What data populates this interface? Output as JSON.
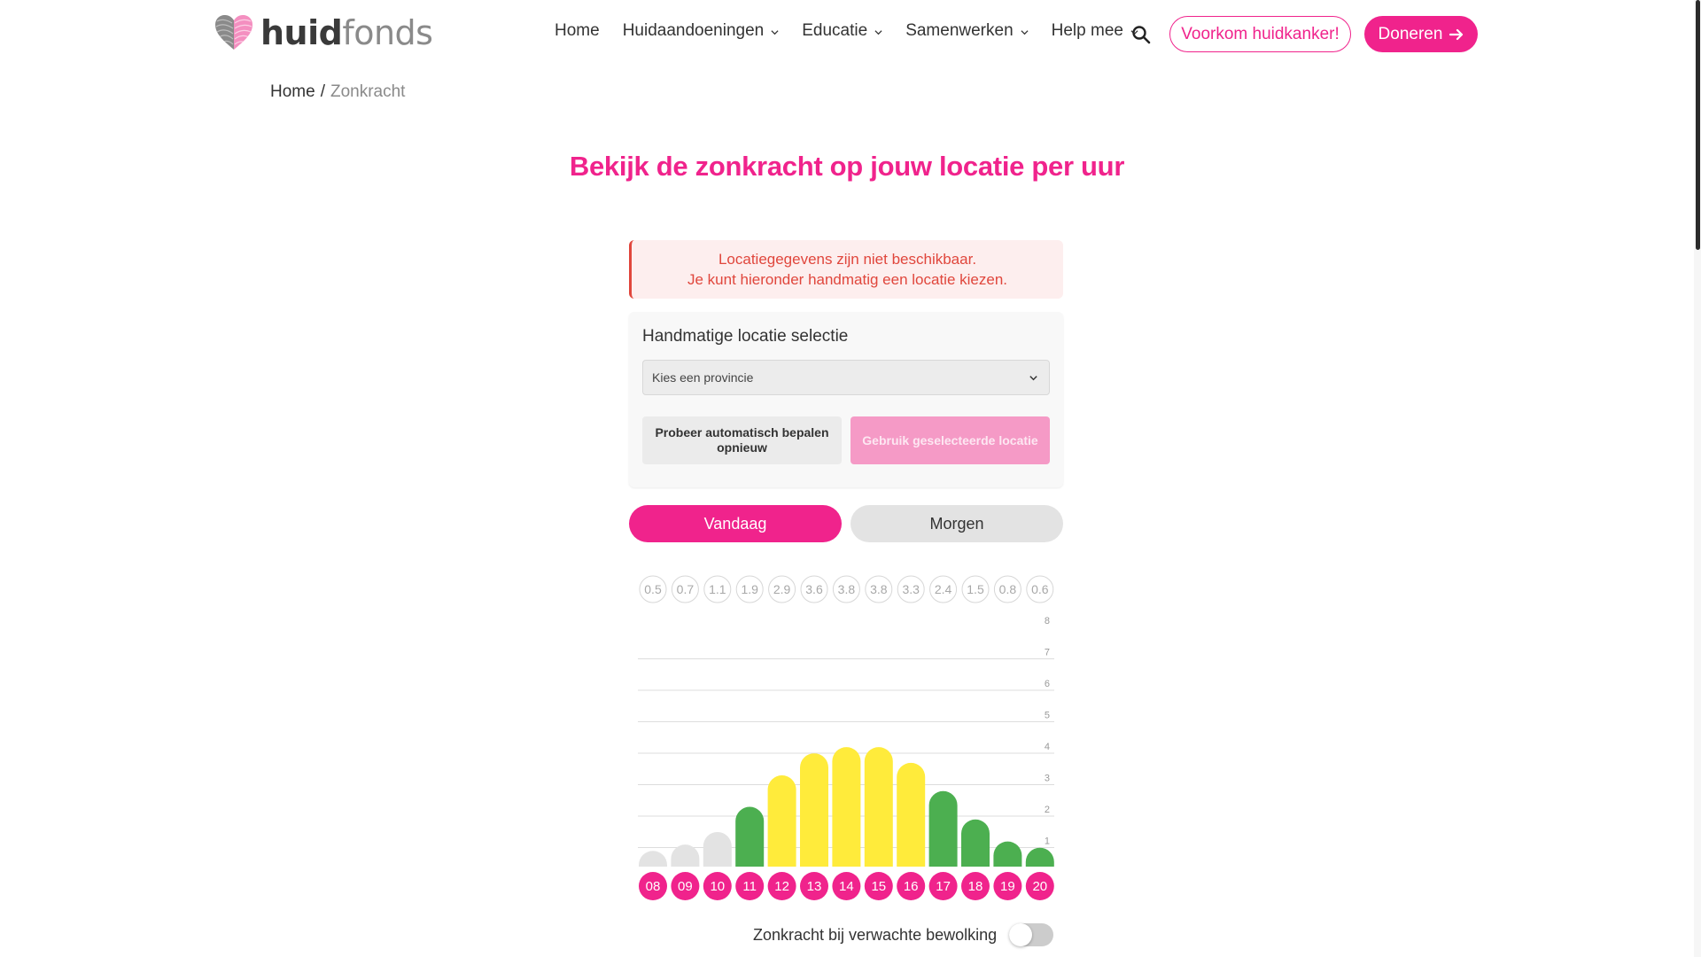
{
  "header": {
    "logo": {
      "text_bold": "huid",
      "text_light": "fonds"
    },
    "nav": [
      {
        "label": "Home",
        "has_dropdown": false
      },
      {
        "label": "Huidaandoeningen",
        "has_dropdown": true
      },
      {
        "label": "Educatie",
        "has_dropdown": true
      },
      {
        "label": "Samenwerken",
        "has_dropdown": true
      },
      {
        "label": "Help mee",
        "has_dropdown": true
      }
    ],
    "search_icon": "search-icon",
    "cta_outline": "Voorkom huidkanker!",
    "cta_fill": "Doneren"
  },
  "breadcrumb": {
    "home": "Home",
    "separator": "/",
    "current": "Zonkracht"
  },
  "page_title": "Bekijk de zonkracht op jouw locatie per uur",
  "alert": {
    "line1": "Locatiegegevens zijn niet beschikbaar.",
    "line2": "Je kunt hieronder handmatig een locatie kiezen."
  },
  "manual_location": {
    "title": "Handmatige locatie selectie",
    "select_value": "Kies een provincie",
    "retry_button": "Probeer automatisch bepalen opnieuw",
    "use_button": "Gebruik geselecteerde locatie"
  },
  "day_toggle": {
    "today": "Vandaag",
    "tomorrow": "Morgen",
    "selected": "today"
  },
  "chart_data": {
    "type": "bar",
    "categories": [
      "08",
      "09",
      "10",
      "11",
      "12",
      "13",
      "14",
      "15",
      "16",
      "17",
      "18",
      "19",
      "20"
    ],
    "values": [
      0.5,
      0.7,
      1.1,
      1.9,
      2.9,
      3.6,
      3.8,
      3.8,
      3.3,
      2.4,
      1.5,
      0.8,
      0.6
    ],
    "value_labels": [
      "0.5",
      "0.7",
      "1.1",
      "1.9",
      "2.9",
      "3.6",
      "3.8",
      "3.8",
      "3.3",
      "2.4",
      "1.5",
      "0.8",
      "0.6"
    ],
    "y_ticks": [
      "8",
      "7",
      "6",
      "5",
      "4",
      "3",
      "2",
      "1"
    ],
    "ylim": [
      0,
      8
    ],
    "grid": true,
    "bar_colors": [
      "#e3e3e3",
      "#e3e3e3",
      "#e3e3e3",
      "#4caf50",
      "#ffeb3b",
      "#ffeb3b",
      "#ffeb3b",
      "#ffeb3b",
      "#ffeb3b",
      "#4caf50",
      "#4caf50",
      "#4caf50",
      "#4caf50"
    ],
    "hour_badge_color": "#f0238c"
  },
  "cloud_toggle": {
    "label": "Zonkracht bij verwachte bewolking",
    "on": false
  },
  "colors": {
    "brand_pink": "#f0238c",
    "alert_red": "#e0463c"
  }
}
